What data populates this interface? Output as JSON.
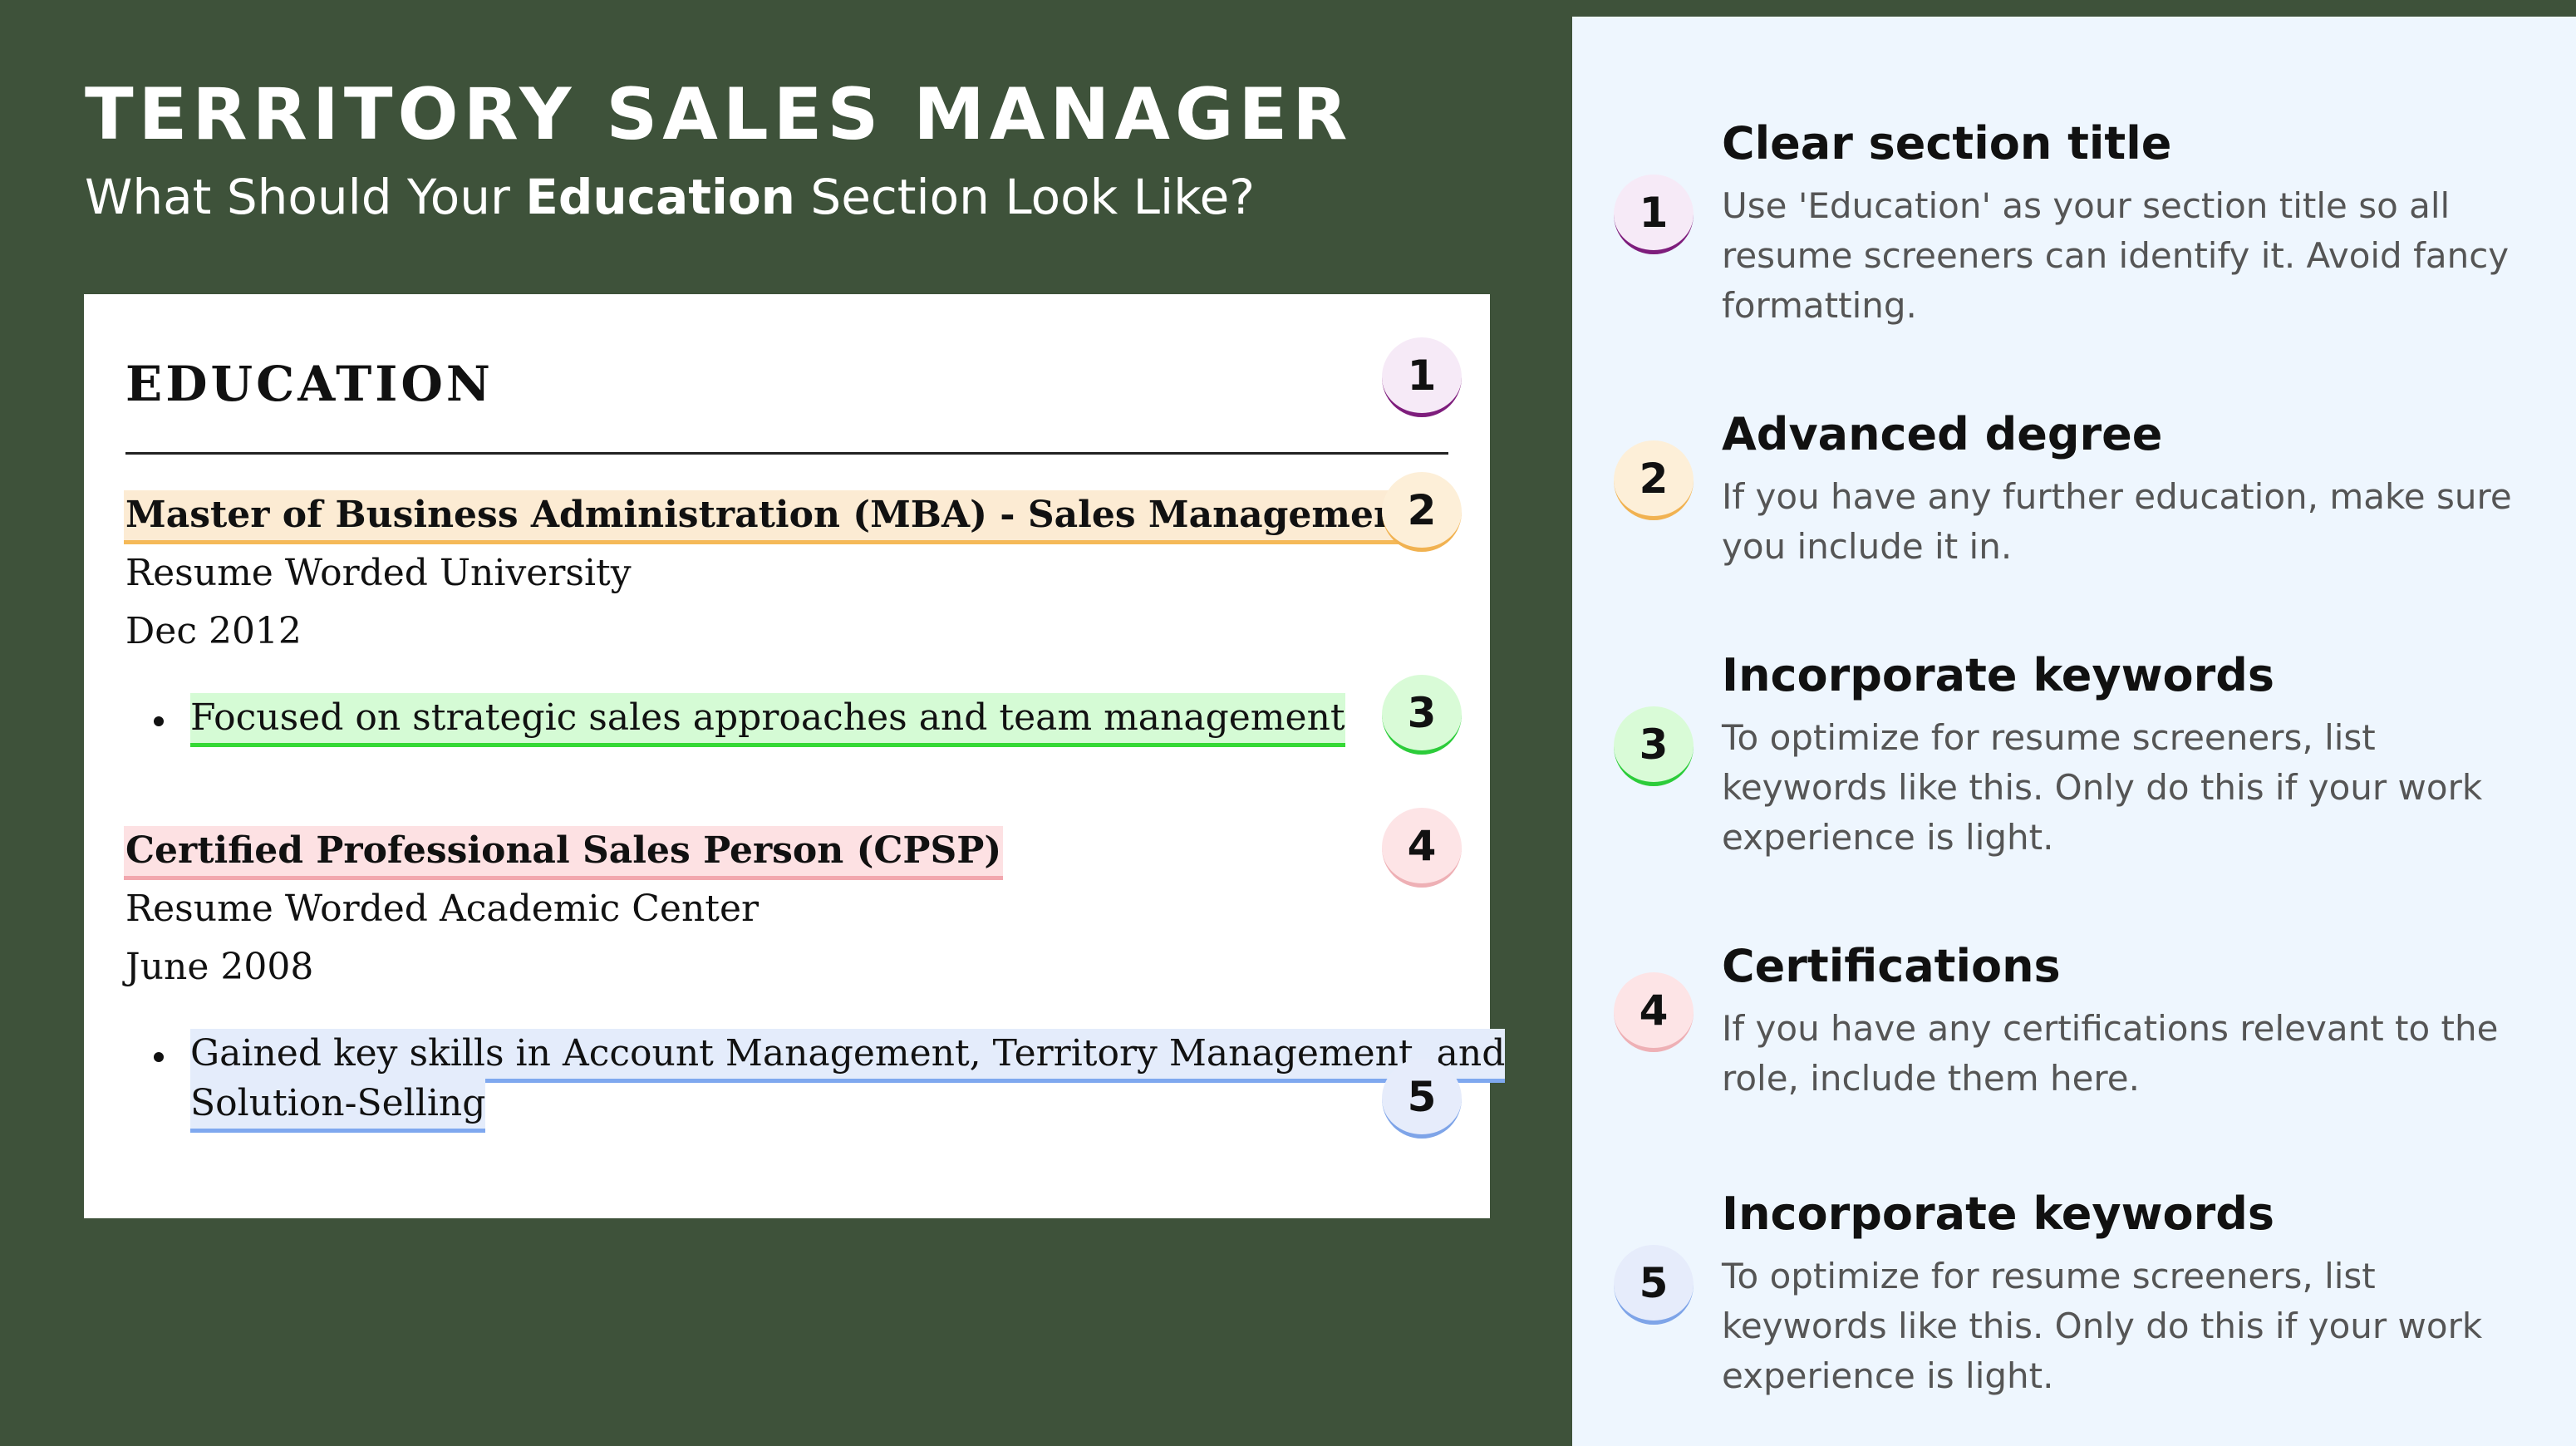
{
  "header": {
    "title": "TERRITORY SALES MANAGER",
    "subtitle_before": "What Should Your ",
    "subtitle_emphasis": "Education",
    "subtitle_after": " Section Look Like?"
  },
  "resume": {
    "section_title": "EDUCATION",
    "entries": [
      {
        "title": "Master of Business Administration (MBA) - Sales Management",
        "institution": "Resume Worded University",
        "date": "Dec 2012",
        "bullet": "Focused on strategic sales approaches and team management"
      },
      {
        "title": "Certified Professional Sales Person (CPSP)",
        "institution": "Resume Worded Academic Center",
        "date": "June 2008",
        "bullet_line1": "Gained key skills in Account Management, Territory Management, and",
        "bullet_line2": "Solution-Selling"
      }
    ],
    "badges": [
      "1",
      "2",
      "3",
      "4",
      "5"
    ]
  },
  "tips": [
    {
      "number": "1",
      "title": "Clear section title",
      "description": "Use 'Education' as your section title so all resume screeners can identify it. Avoid fancy formatting."
    },
    {
      "number": "2",
      "title": "Advanced degree",
      "description": "If you have any further education, make sure you include it in."
    },
    {
      "number": "3",
      "title": "Incorporate keywords",
      "description": "To optimize for resume screeners, list keywords like this. Only do this if your work experience is light."
    },
    {
      "number": "4",
      "title": "Certifications",
      "description": "If you have any certifications relevant to the role, include them here."
    },
    {
      "number": "5",
      "title": "Incorporate keywords",
      "description": "To optimize for resume screeners, list keywords like this. Only do this if your work experience is light."
    }
  ],
  "colors": {
    "background": "#3e523a",
    "panel": "#eef6fe",
    "badge1_accent": "#7e1d7c",
    "badge2_accent": "#f1b251",
    "badge3_accent": "#2ccc3a",
    "badge4_accent": "#eeb0b5",
    "badge5_accent": "#7ea4e8"
  }
}
